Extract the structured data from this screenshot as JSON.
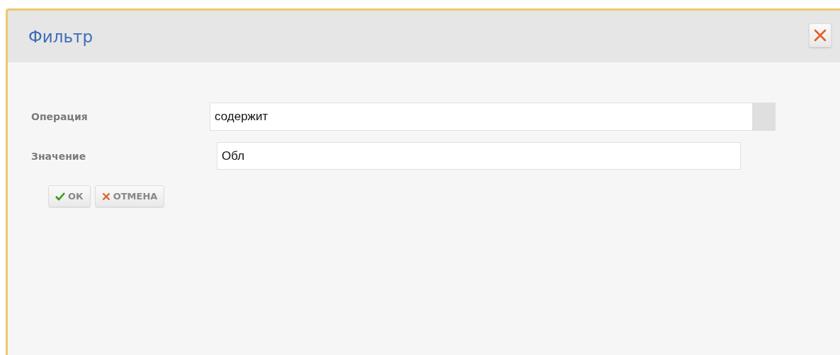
{
  "dialog": {
    "title": "Фильтр"
  },
  "fields": [
    {
      "label": "Операция",
      "kind": "combo",
      "value": "содержит"
    },
    {
      "label": "Значение",
      "kind": "text",
      "value": "Обл"
    }
  ],
  "buttons": [
    {
      "label": "ОК",
      "kind": "ok"
    },
    {
      "label": "ОТМЕНА",
      "kind": "cancel"
    }
  ]
}
